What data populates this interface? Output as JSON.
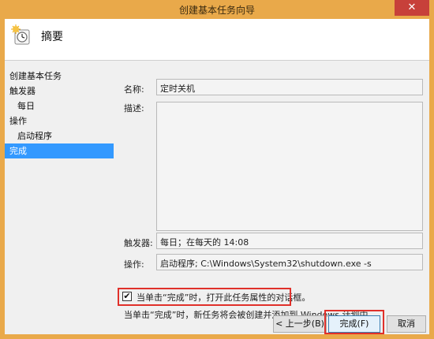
{
  "window": {
    "title": "创建基本任务向导",
    "close_glyph": "✕"
  },
  "header": {
    "icon": "task-wizard-icon",
    "title": "摘要"
  },
  "nav": {
    "items": [
      {
        "label": "创建基本任务",
        "level": 0,
        "selected": false
      },
      {
        "label": "触发器",
        "level": 0,
        "selected": false
      },
      {
        "label": "每日",
        "level": 1,
        "selected": false
      },
      {
        "label": "操作",
        "level": 0,
        "selected": false
      },
      {
        "label": "启动程序",
        "level": 1,
        "selected": false
      },
      {
        "label": "完成",
        "level": 0,
        "selected": true
      }
    ]
  },
  "summary": {
    "name_label": "名称:",
    "name_value": "定时关机",
    "description_label": "描述:",
    "description_value": "",
    "trigger_label": "触发器:",
    "trigger_value": "每日；在每天的 14:08",
    "action_label": "操作:",
    "action_value": "启动程序; C:\\Windows\\System32\\shutdown.exe -s"
  },
  "open_properties": {
    "label": "当单击“完成”时，打开此任务属性的对话框。",
    "checked": true,
    "check_glyph": "✔"
  },
  "note": "当单击“完成”时，新任务将会被创建并添加到 Windows 计划中。",
  "buttons": {
    "back": "< 上一步(B)",
    "finish": "完成(F)",
    "cancel": "取消"
  },
  "colors": {
    "titlebar": "#e9a94a",
    "highlight": "#e0302a",
    "selection": "#3399ff"
  }
}
